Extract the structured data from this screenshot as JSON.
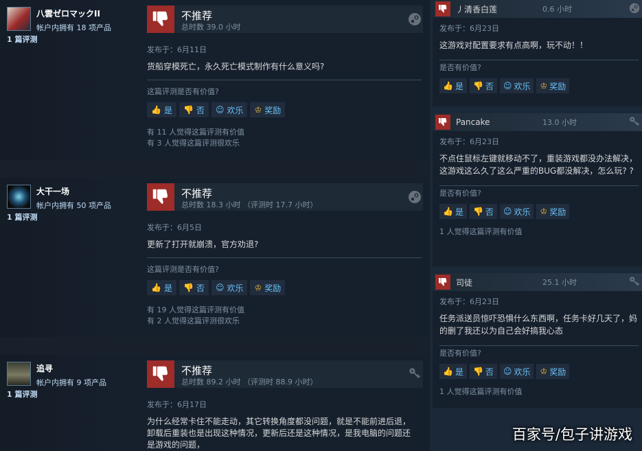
{
  "reviews": [
    {
      "persona": "八雲ゼロマックII",
      "owned": "帐户内拥有 18 项产品",
      "review_count": "1 篇评测",
      "vote": "不推荐",
      "hours": "总时数 39.0 小时",
      "posted": "发布于：6月11日",
      "content": "货船穿模死亡，永久死亡模式制作有什么意义吗?",
      "helpful_q": "这篇评测是否有价值?",
      "stat_helpful": "有 11 人觉得这篇评测有价值",
      "stat_funny": "有 3 人觉得这篇评测很欢乐"
    },
    {
      "persona": "大干一场",
      "owned": "帐户内拥有 50 项产品",
      "review_count": "1 篇评测",
      "vote": "不推荐",
      "hours": "总时数 18.3 小时  （评测时 17.7 小时）",
      "posted": "发布于：6月5日",
      "content": "更新了打开就崩溃，官方劝退?",
      "helpful_q": "这篇评测是否有价值?",
      "stat_helpful": "有 19 人觉得这篇评测有价值",
      "stat_funny": "有 2 人觉得这篇评测很欢乐"
    },
    {
      "persona": "追寻",
      "owned": "帐户内拥有 9 项产品",
      "review_count": "1 篇评测",
      "vote": "不推荐",
      "hours": "总时数 89.2 小时  （评测时 88.9 小时）",
      "posted": "发布于：6月17日",
      "content": "为什么经常卡住不能走动，其它转换角度都没问题，就是不能前进后退，卸载后重装也是出现这种情况，更新后还是这种情况，是我电脑的问题还是游戏的问题，"
    }
  ],
  "buttons": {
    "yes": "是",
    "no": "否",
    "funny": "欢乐",
    "award": "奖励"
  },
  "side_reviews": [
    {
      "name": "丿清香白莲",
      "hours": "0.6 小时",
      "posted": "发布于：6月23日",
      "content": "这游戏对配置要求有点高啊，玩不动！！",
      "helpful_q": "是否有价值?"
    },
    {
      "name": "Pancake",
      "hours": "13.0 小时",
      "posted": "发布于：6月23日",
      "content": "不点住鼠标左键就移动不了，重装游戏都没办法解决，这游戏这么久了这么严重的BUG都没解决，怎么玩? ?",
      "helpful_q": "是否有价值?",
      "stat": "1 人觉得这篇评测有价值"
    },
    {
      "name": "司徒",
      "hours": "25.1 小时",
      "posted": "发布于：6月23日",
      "content": "任务派送员惊吓恐惧什么东西啊，任务卡好几天了，妈的删了我还以为自己会好搞我心态",
      "helpful_q": "是否有价值?",
      "stat": "1 人觉得这篇评测有价值"
    }
  ],
  "watermark": "百家号/包子讲游戏",
  "colors": {
    "thumb_down": "#9e2c29",
    "link": "#67c1f5",
    "award": "#e6b836"
  },
  "icons": {
    "vote": "thumbs-down-icon",
    "steam": "steam-icon",
    "key": "key-icon"
  }
}
